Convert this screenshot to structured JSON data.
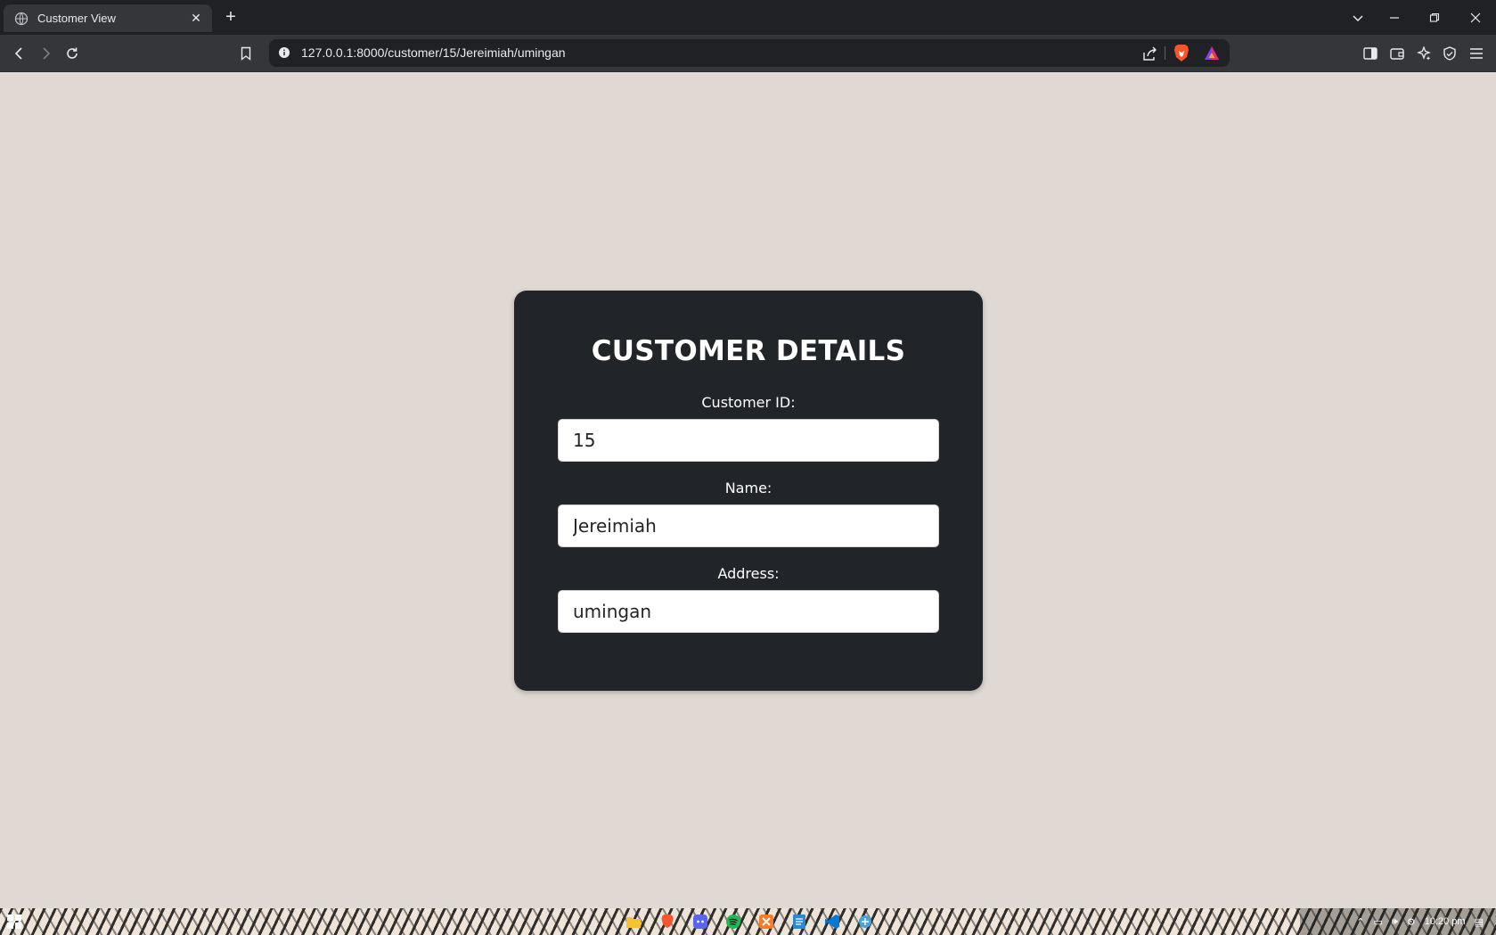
{
  "browser": {
    "tab_title": "Customer View",
    "url": "127.0.0.1:8000/customer/15/Jereimiah/umingan"
  },
  "card": {
    "title": "CUSTOMER DETAILS",
    "fields": [
      {
        "label": "Customer ID:",
        "value": "15"
      },
      {
        "label": "Name:",
        "value": "Jereimiah"
      },
      {
        "label": "Address:",
        "value": "umingan"
      }
    ]
  },
  "taskbar": {
    "clock": "10:20 pm"
  },
  "colors": {
    "page_background": "#e0d8d2",
    "card_background": "#212428",
    "input_background": "#ffffff",
    "browser_chrome": "#35363a"
  }
}
